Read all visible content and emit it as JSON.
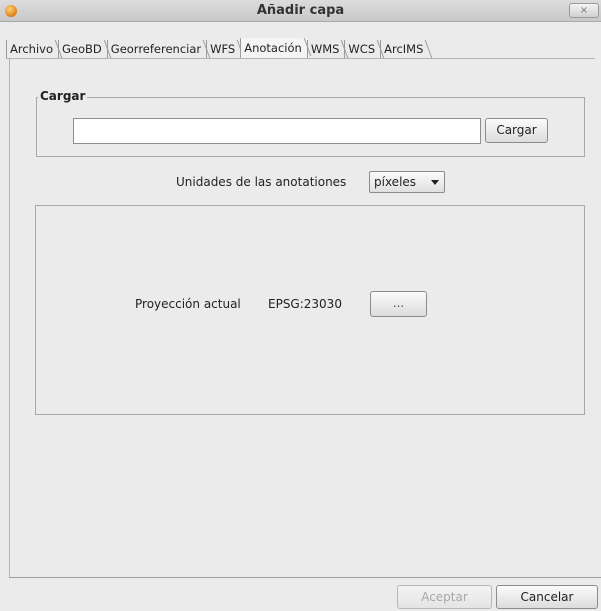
{
  "window": {
    "title": "Añadir capa",
    "close_label": "×"
  },
  "tabs": [
    {
      "label": "Archivo",
      "active": false
    },
    {
      "label": "GeoBD",
      "active": false
    },
    {
      "label": "Georreferenciar",
      "active": false
    },
    {
      "label": "WFS",
      "active": false
    },
    {
      "label": "Anotación",
      "active": true
    },
    {
      "label": "WMS",
      "active": false
    },
    {
      "label": "WCS",
      "active": false
    },
    {
      "label": "ArcIMS",
      "active": false
    }
  ],
  "load_group": {
    "legend": "Cargar",
    "file_value": "",
    "button_label": "Cargar"
  },
  "units": {
    "label": "Unidades de las anotationes",
    "selected": "píxeles"
  },
  "projection": {
    "label": "Proyección actual",
    "value": "EPSG:23030",
    "button_label": "..."
  },
  "footer": {
    "accept_label": "Aceptar",
    "accept_enabled": false,
    "cancel_label": "Cancelar"
  }
}
